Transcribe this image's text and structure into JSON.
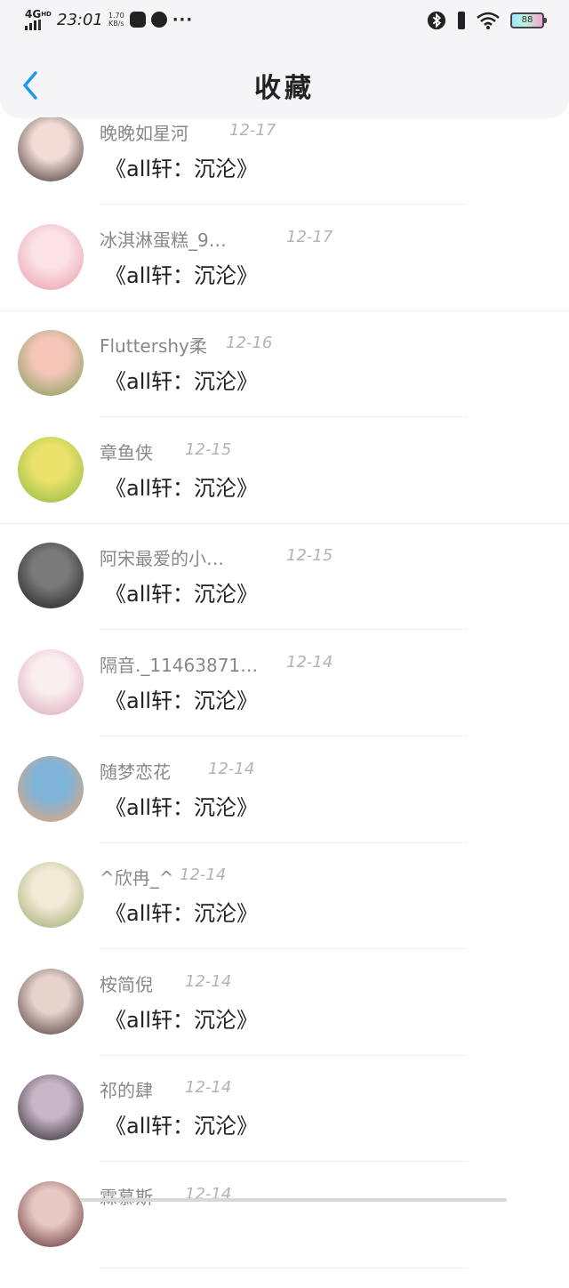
{
  "status_bar": {
    "network": "4G",
    "network_sup": "HD",
    "time": "23:01",
    "speed_value": "1.70",
    "speed_unit": "KB/s",
    "battery": "88",
    "icons": [
      "signal-icon",
      "app-notification-icon",
      "app-notification-icon-2",
      "more-dots-icon",
      "bluetooth-icon",
      "vibrate-icon",
      "wifi-icon",
      "battery-icon"
    ]
  },
  "header": {
    "title": "收藏",
    "back_icon": "chevron-left-icon"
  },
  "favorites": [
    {
      "user": "晚晚如星河",
      "date": "12-17",
      "title": "《all轩：沉沦》",
      "avatar_colors": [
        "#f2ddd6",
        "#3a2a28"
      ]
    },
    {
      "user": "冰淇淋蛋糕_9…",
      "date": "12-17",
      "title": "《all轩：沉沦》",
      "avatar_colors": [
        "#fbe2e6",
        "#e89aa8"
      ]
    },
    {
      "user": "Fluttershy柔",
      "date": "12-16",
      "title": "《all轩：沉沦》",
      "avatar_colors": [
        "#f5c6b8",
        "#7a9a54"
      ]
    },
    {
      "user": "章鱼侠",
      "date": "12-15",
      "title": "《all轩：沉沦》",
      "avatar_colors": [
        "#eae26a",
        "#8ab844"
      ]
    },
    {
      "user": "阿宋最爱的小…",
      "date": "12-15",
      "title": "《all轩：沉沦》",
      "avatar_colors": [
        "#7a7a7a",
        "#1a1a1a"
      ]
    },
    {
      "user": "隔音._11463871…",
      "date": "12-14",
      "title": "《all轩：沉沦》",
      "avatar_colors": [
        "#fbeef0",
        "#d8a4b2"
      ]
    },
    {
      "user": "随梦恋花",
      "date": "12-14",
      "title": "《all轩：沉沦》",
      "avatar_colors": [
        "#7fb3d8",
        "#f2a36c"
      ]
    },
    {
      "user": "^欣冉_^",
      "date": "12-14",
      "title": "《all轩：沉沦》",
      "avatar_colors": [
        "#f3ead8",
        "#9aa86a"
      ]
    },
    {
      "user": "桉简倪",
      "date": "12-14",
      "title": "《all轩：沉沦》",
      "avatar_colors": [
        "#e6d3cc",
        "#4a3430"
      ]
    },
    {
      "user": "祁的肆",
      "date": "12-14",
      "title": "《all轩：沉沦》",
      "avatar_colors": [
        "#c9b7c8",
        "#221c22"
      ]
    },
    {
      "user": "霖慕斯",
      "date": "12-14",
      "title": "",
      "avatar_colors": [
        "#e8c8c4",
        "#5a2a2a"
      ]
    }
  ]
}
